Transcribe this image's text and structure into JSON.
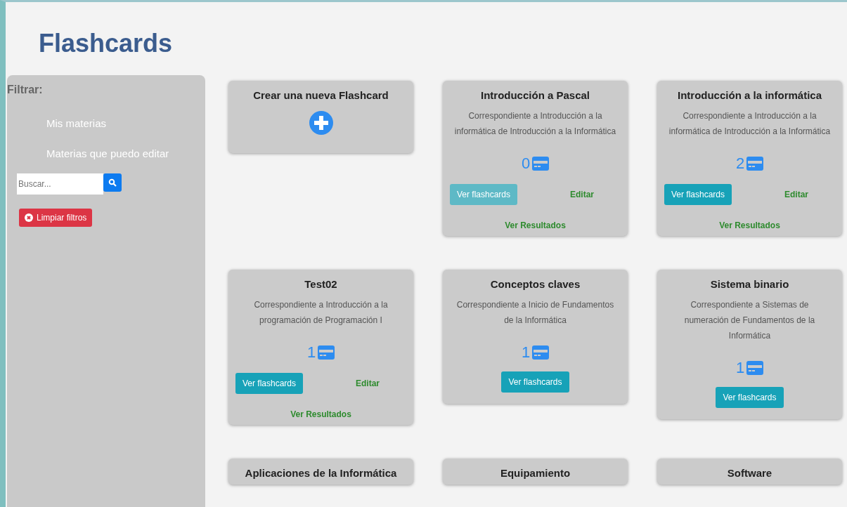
{
  "page_title": "Flashcards",
  "sidebar": {
    "heading": "Filtrar:",
    "filters": [
      {
        "label": "Mis materias"
      },
      {
        "label": "Materias que puedo editar"
      }
    ],
    "search": {
      "placeholder": "Buscar..."
    },
    "clear_button": "Limpiar filtros"
  },
  "cards": [
    {
      "kind": "create",
      "title": "Crear una nueva Flashcard"
    },
    {
      "kind": "deck",
      "title": "Introducción a Pascal",
      "description": "Correspondiente a Introducción a la informática de Introducción a la Informática",
      "count": "0",
      "view_button": {
        "label": "Ver flashcards",
        "disabled": true
      },
      "edit_link": "Editar",
      "results_link": "Ver Resultados"
    },
    {
      "kind": "deck",
      "title": "Introducción a la informática",
      "description": "Correspondiente a Introducción a la informática de Introducción a la Informática",
      "count": "2",
      "view_button": {
        "label": "Ver flashcards",
        "disabled": false
      },
      "edit_link": "Editar",
      "results_link": "Ver Resultados"
    },
    {
      "kind": "deck",
      "title": "Test02",
      "description": "Correspondiente a Introducción a la programación de Programación I",
      "count": "1",
      "view_button": {
        "label": "Ver flashcards",
        "disabled": false
      },
      "edit_link": "Editar",
      "results_link": "Ver Resultados"
    },
    {
      "kind": "deck",
      "title": "Conceptos claves",
      "description": "Correspondiente a Inicio de Fundamentos de la Informática",
      "count": "1",
      "view_button": {
        "label": "Ver flashcards",
        "disabled": false
      }
    },
    {
      "kind": "deck",
      "title": "Sistema binario",
      "description": "Correspondiente a Sistemas de numeración de Fundamentos de la Informática",
      "count": "1",
      "view_button": {
        "label": "Ver flashcards",
        "disabled": false
      }
    },
    {
      "kind": "deck",
      "title": "Aplicaciones de la Informática"
    },
    {
      "kind": "deck",
      "title": "Equipamiento"
    },
    {
      "kind": "deck",
      "title": "Software"
    }
  ]
}
